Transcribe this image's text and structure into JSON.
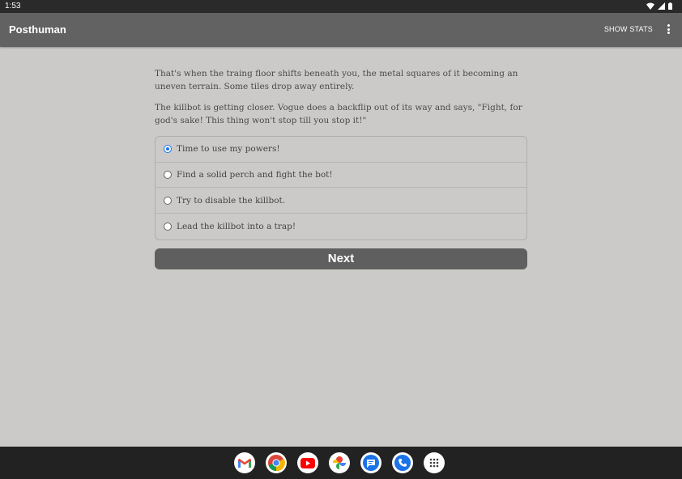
{
  "status_bar": {
    "time": "1:53"
  },
  "app_bar": {
    "title": "Posthuman",
    "show_stats_label": "SHOW STATS"
  },
  "story": {
    "paragraphs": [
      "That's when the traing floor shifts beneath you, the metal squares of it becoming an uneven terrain. Some tiles drop away entirely.",
      "The killbot is getting closer. Vogue does a backflip out of its way and says, \"Fight, for god's sake! This thing won't stop till you stop it!\""
    ],
    "choices": [
      {
        "label": "Time to use my powers!",
        "selected": true
      },
      {
        "label": "Find a solid perch and fight the bot!",
        "selected": false
      },
      {
        "label": "Try to disable the killbot.",
        "selected": false
      },
      {
        "label": "Lead the killbot into a trap!",
        "selected": false
      }
    ],
    "next_label": "Next"
  },
  "dock": {
    "apps": [
      {
        "name": "gmail-icon"
      },
      {
        "name": "chrome-icon"
      },
      {
        "name": "youtube-icon"
      },
      {
        "name": "photos-icon"
      },
      {
        "name": "messages-icon"
      },
      {
        "name": "phone-icon"
      },
      {
        "name": "app-drawer-icon"
      }
    ]
  },
  "colors": {
    "accent": "#1a73e8",
    "app_bar": "#626262",
    "background": "#cccac8",
    "button": "#5f5f5f"
  }
}
